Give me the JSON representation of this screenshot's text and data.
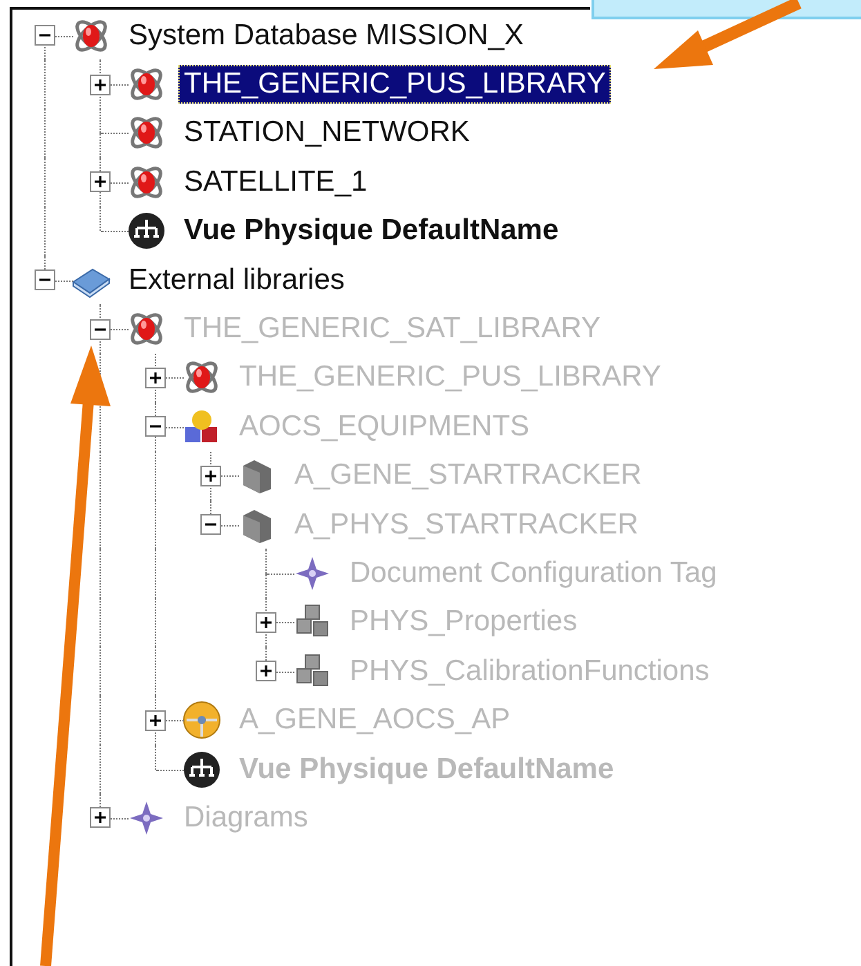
{
  "tree": [
    {
      "label": "System Database MISSION_X",
      "kind": "system",
      "expanded": true,
      "selected": false,
      "dimmed": false,
      "children": [
        {
          "label": "THE_GENERIC_PUS_LIBRARY",
          "kind": "system",
          "expanded": false,
          "selected": true,
          "dimmed": false
        },
        {
          "label": "STATION_NETWORK",
          "kind": "system",
          "selected": false,
          "dimmed": false
        },
        {
          "label": "SATELLITE_1",
          "kind": "system",
          "expanded": false,
          "selected": false,
          "dimmed": false
        },
        {
          "label": "Vue Physique DefaultName",
          "kind": "view",
          "bold": true,
          "selected": false,
          "dimmed": false
        }
      ]
    },
    {
      "label": "External libraries",
      "kind": "book",
      "expanded": true,
      "selected": false,
      "dimmed": false,
      "children": [
        {
          "label": "THE_GENERIC_SAT_LIBRARY",
          "kind": "system",
          "expanded": true,
          "selected": false,
          "dimmed": true,
          "children": [
            {
              "label": "THE_GENERIC_PUS_LIBRARY",
              "kind": "system",
              "expanded": false,
              "selected": false,
              "dimmed": true
            },
            {
              "label": "AOCS_EQUIPMENTS",
              "kind": "equipment-group",
              "expanded": true,
              "selected": false,
              "dimmed": true,
              "children": [
                {
                  "label": "A_GENE_STARTRACKER",
                  "kind": "device",
                  "expanded": false,
                  "selected": false,
                  "dimmed": true
                },
                {
                  "label": "A_PHYS_STARTRACKER",
                  "kind": "device",
                  "expanded": true,
                  "selected": false,
                  "dimmed": true,
                  "children": [
                    {
                      "label": "Document  Configuration Tag",
                      "kind": "tag",
                      "selected": false,
                      "dimmed": true
                    },
                    {
                      "label": "PHYS_Properties",
                      "kind": "component-group",
                      "expanded": false,
                      "selected": false,
                      "dimmed": true
                    },
                    {
                      "label": "PHYS_CalibrationFunctions",
                      "kind": "component-group",
                      "expanded": false,
                      "selected": false,
                      "dimmed": true
                    }
                  ]
                }
              ]
            },
            {
              "label": "A_GENE_AOCS_AP",
              "kind": "application",
              "expanded": false,
              "selected": false,
              "dimmed": true
            },
            {
              "label": "Vue Physique DefaultName",
              "kind": "view",
              "bold": true,
              "selected": false,
              "dimmed": true
            }
          ]
        },
        {
          "label": "Diagrams",
          "kind": "tag",
          "expanded": false,
          "selected": false,
          "dimmed": true
        }
      ]
    }
  ]
}
